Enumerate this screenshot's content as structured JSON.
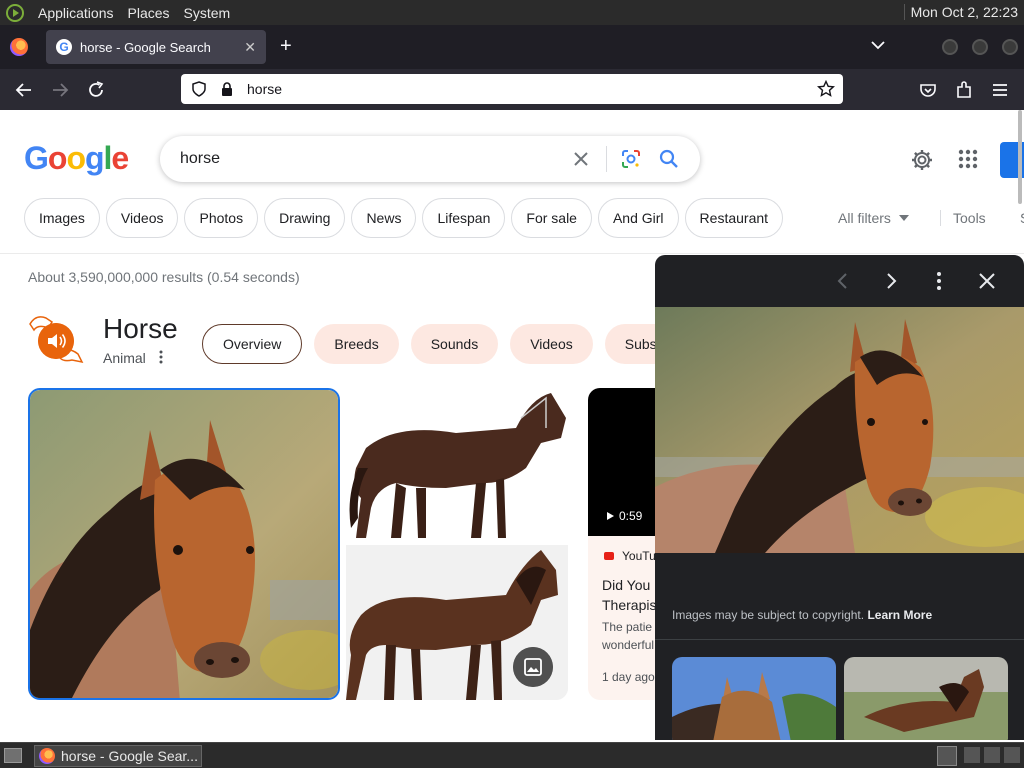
{
  "panel": {
    "menus": [
      "Applications",
      "Places",
      "System"
    ],
    "clock": "Mon Oct  2, 22:23"
  },
  "browser": {
    "tab_title": "horse - Google Search",
    "url": "horse"
  },
  "search": {
    "query": "horse",
    "chips": [
      "Images",
      "Videos",
      "Photos",
      "Drawing",
      "News",
      "Lifespan",
      "For sale",
      "And Girl",
      "Restaurant"
    ],
    "all_filters": "All filters",
    "tools": "Tools",
    "tools_overflow": "S"
  },
  "results": {
    "stats": "About 3,590,000,000 results (0.54 seconds)"
  },
  "knowledge_panel": {
    "title": "Horse",
    "subtitle": "Animal",
    "tabs": [
      "Overview",
      "Breeds",
      "Sounds",
      "Videos",
      "Subspec"
    ],
    "active_tab": "Overview"
  },
  "video": {
    "duration": "0:59",
    "source": "YouTu",
    "title_line1": "Did You",
    "title_line2": "Therapis",
    "desc_line1": "The patie",
    "desc_line2": "wonderful",
    "age": "1 day ago"
  },
  "viewer": {
    "copyright": "Images may be subject to copyright.",
    "learn_more": "Learn More"
  },
  "taskbar": {
    "task_label": "horse - Google Sear..."
  }
}
